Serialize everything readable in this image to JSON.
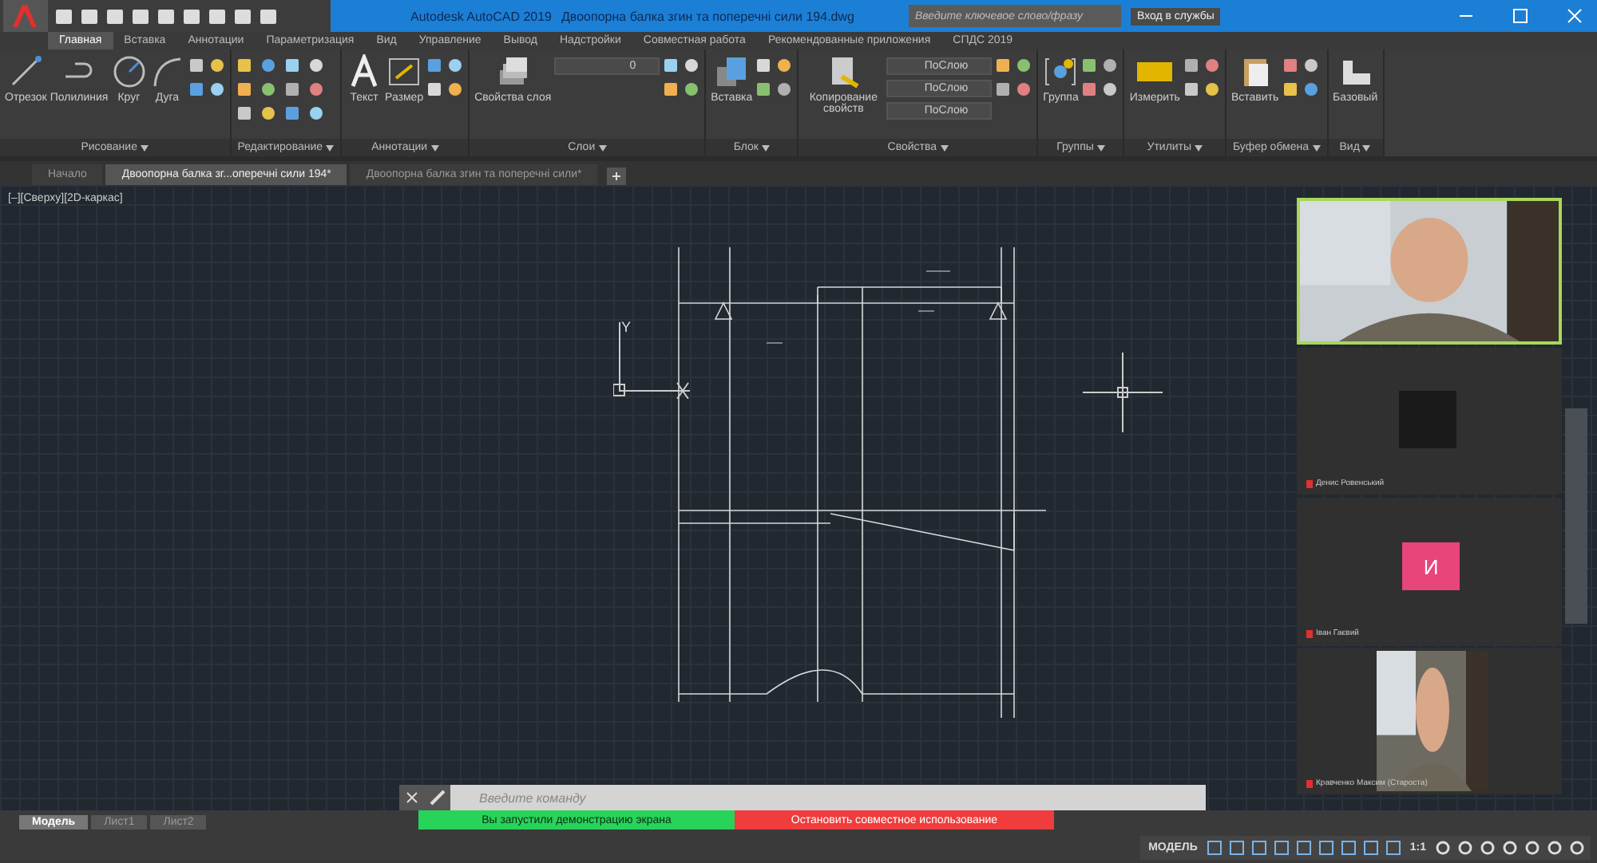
{
  "window": {
    "title": "Autodesk AutoCAD 2019",
    "file": "Двоопорна балка згин та поперечні сили 194.dwg"
  },
  "search": {
    "placeholder": "Введите ключевое слово/фразу"
  },
  "signin": {
    "label": "Вход в службы"
  },
  "menu_tabs": [
    {
      "label": "Главная",
      "selected": true
    },
    {
      "label": "Вставка",
      "selected": false
    },
    {
      "label": "Аннотации",
      "selected": false
    },
    {
      "label": "Параметризация",
      "selected": false
    },
    {
      "label": "Вид",
      "selected": false
    },
    {
      "label": "Управление",
      "selected": false
    },
    {
      "label": "Вывод",
      "selected": false
    },
    {
      "label": "Надстройки",
      "selected": false
    },
    {
      "label": "Совместная работа",
      "selected": false
    },
    {
      "label": "Рекомендованные приложения",
      "selected": false
    },
    {
      "label": "СПДС 2019",
      "selected": false
    }
  ],
  "ribbon_groups": [
    {
      "title": "Рисование",
      "tools": [
        "Отрезок",
        "Полилиния",
        "Круг",
        "Дуга"
      ]
    },
    {
      "title": "Редактирование"
    },
    {
      "title": "Аннотации",
      "tools": [
        "Текст",
        "Размер"
      ]
    },
    {
      "title": "Слои",
      "tools": [
        "Свойства слоя"
      ],
      "dropdowns": [
        "0"
      ]
    },
    {
      "title": "Блок",
      "tools": [
        "Вставка"
      ]
    },
    {
      "title": "Свойства",
      "tools": [
        "Копирование свойств"
      ],
      "dropdowns": [
        "ПоСлою",
        "ПоСлою",
        "ПоСлою"
      ]
    },
    {
      "title": "Группы",
      "tools": [
        "Группа"
      ]
    },
    {
      "title": "Утилиты",
      "tools": [
        "Измерить"
      ]
    },
    {
      "title": "Буфер обмена",
      "tools": [
        "Вставить"
      ]
    },
    {
      "title": "Вид",
      "tools": [
        "Базовый"
      ]
    }
  ],
  "file_tabs": [
    {
      "label": "Начало",
      "selected": false
    },
    {
      "label": "Двоопорна балка зг...оперечні сили 194*",
      "selected": true
    },
    {
      "label": "Двоопорна балка згин та поперечні сили*",
      "selected": false
    }
  ],
  "viewport_label": "[–][Сверху][2D-каркас]",
  "ucs_label": "Y",
  "participants": [
    {
      "kind": "video",
      "selected": true
    },
    {
      "kind": "blank",
      "name": "Денис Ровенський",
      "selected": false
    },
    {
      "kind": "avatar",
      "initial": "И",
      "name": "Іван Гаєвий",
      "selected": false
    },
    {
      "kind": "video_small",
      "name": "Кравченко Максим (Староста)",
      "selected": false
    }
  ],
  "command": {
    "placeholder": "Введите команду"
  },
  "share_notice": {
    "message": "Вы запустили демонстрацию экрана",
    "stop": "Остановить совместное использование"
  },
  "layout_tabs": [
    {
      "label": "Модель",
      "selected": true
    },
    {
      "label": "Лист1",
      "selected": false
    },
    {
      "label": "Лист2",
      "selected": false
    }
  ],
  "status_bar": {
    "mode": "МОДЕЛЬ",
    "scale": "1:1"
  }
}
